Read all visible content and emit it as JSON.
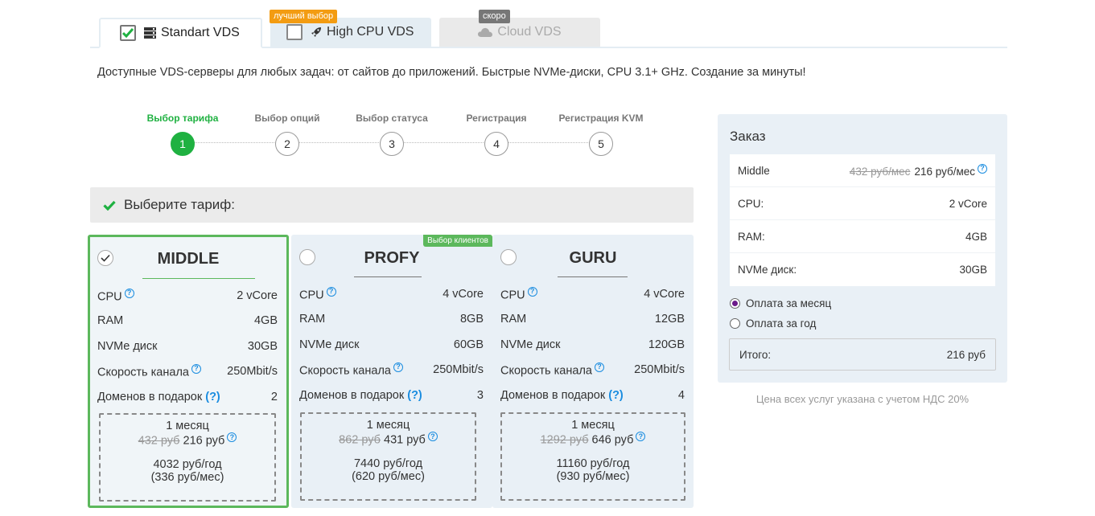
{
  "tabs": [
    {
      "label": "Standart VDS",
      "checked": true,
      "icon": "server-icon"
    },
    {
      "label": "High CPU VDS",
      "checked": false,
      "icon": "rocket-icon",
      "badge": "лучший выбор"
    },
    {
      "label": "Cloud VDS",
      "icon": "cloud-icon",
      "badge": "скоро",
      "disabled": true
    }
  ],
  "intro": "Доступные VDS-серверы для любых задач: от сайтов до приложений. Быстрые NVMe-диски, CPU 3.1+ GHz. Создание за минуты!",
  "steps": [
    {
      "label": "Выбор тарифа",
      "num": "1",
      "active": true
    },
    {
      "label": "Выбор опций",
      "num": "2"
    },
    {
      "label": "Выбор статуса",
      "num": "3"
    },
    {
      "label": "Регистрация",
      "num": "4"
    },
    {
      "label": "Регистрация KVM",
      "num": "5"
    }
  ],
  "section_title": "Выберите тариф:",
  "spec_labels": {
    "cpu": "CPU",
    "ram": "RAM",
    "disk": "NVMe диск",
    "speed": "Скорость канала",
    "domains": "Доменов в подарок"
  },
  "help_glyph": "?",
  "plans": [
    {
      "name": "MIDDLE",
      "selected": true,
      "cpu": "2 vCore",
      "ram": "4GB",
      "disk": "30GB",
      "speed": "250Mbit/s",
      "domains": "2",
      "period": "1 месяц",
      "old_price": "432 руб",
      "price": "216 руб",
      "year_price": "4032 руб/год",
      "year_monthly": "(336 руб/мес)"
    },
    {
      "name": "PROFY",
      "selected": false,
      "badge": "Выбор клиентов",
      "cpu": "4 vCore",
      "ram": "8GB",
      "disk": "60GB",
      "speed": "250Mbit/s",
      "domains": "3",
      "period": "1 месяц",
      "old_price": "862 руб",
      "price": "431 руб",
      "year_price": "7440 руб/год",
      "year_monthly": "(620 руб/мес)"
    },
    {
      "name": "GURU",
      "selected": false,
      "cpu": "4 vCore",
      "ram": "12GB",
      "disk": "120GB",
      "speed": "250Mbit/s",
      "domains": "4",
      "period": "1 месяц",
      "old_price": "1292 руб",
      "price": "646 руб",
      "year_price": "11160 руб/год",
      "year_monthly": "(930 руб/мес)"
    }
  ],
  "order": {
    "title": "Заказ",
    "plan_name": "Middle",
    "old_price": "432 руб/мес",
    "price": "216 руб/мес",
    "rows": [
      {
        "label": "CPU:",
        "value": "2 vCore"
      },
      {
        "label": "RAM:",
        "value": "4GB"
      },
      {
        "label": "NVMe диск:",
        "value": "30GB"
      }
    ],
    "pay_month": "Оплата за месяц",
    "pay_year": "Оплата за год",
    "total_label": "Итого:",
    "total_value": "216 руб"
  },
  "vat_note": "Цена всех услуг указана с учетом НДС 20%",
  "colors": {
    "accent_green": "#1fb141",
    "selected_border": "#5cb85c",
    "badge_orange": "#f39c12",
    "help_blue": "#1b8de0",
    "card_bg": "#e9f0f6"
  }
}
